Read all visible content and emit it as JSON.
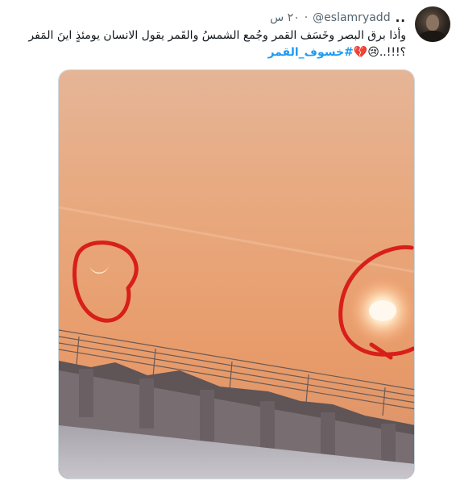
{
  "tweet": {
    "avatar": "avatar-photo",
    "more_label": "..",
    "handle": "@eslamryadd",
    "time": "٢٠ س",
    "separator": "·",
    "text_line_1": "وأذا برق البصر وخَسَف القمر  وجُمع الشمسُ والقَمر يقول الانسان يومئذٍ اينَ المَفر",
    "text_line_2_prefix": "؟!!!..",
    "emoji": "😢💔",
    "hashtag": "#خسوف_القمر"
  },
  "media": {
    "image": "photo-sun-and-crescent-circled",
    "colors": {
      "sky_top": "#e7b493",
      "sky_bottom": "#e8a070",
      "circle": "#d81f1a",
      "sun": "#fff6e8"
    }
  }
}
